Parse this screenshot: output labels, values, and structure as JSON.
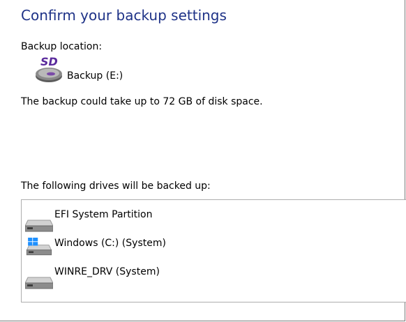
{
  "title": "Confirm your backup settings",
  "backup_location": {
    "label": "Backup location:",
    "icon": "sd-card-drive-icon",
    "icon_text": "SD",
    "value": "Backup (E:)"
  },
  "space_text": "The backup could take up to 72 GB of disk space.",
  "drives": {
    "label": "The following drives will be backed up:",
    "items": [
      {
        "name": "EFI System Partition",
        "icon": "hard-drive-icon"
      },
      {
        "name": "Windows (C:) (System)",
        "icon": "windows-drive-icon"
      },
      {
        "name": "WINRE_DRV (System)",
        "icon": "hard-drive-icon"
      }
    ]
  },
  "colors": {
    "title": "#1e3287",
    "sd_label": "#5a2a9c"
  }
}
